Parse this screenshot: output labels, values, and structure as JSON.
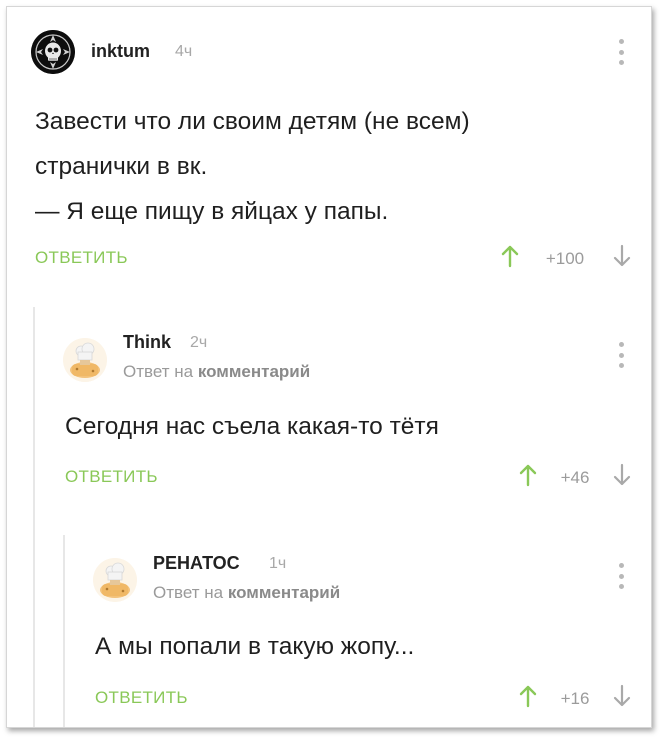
{
  "accent_color": "#8ac858",
  "comments": [
    {
      "author": "inktum",
      "time": "4ч",
      "avatar_icon": "skull-emblem",
      "reply_prefix": "",
      "reply_link": "",
      "lines": [
        "Завести что ли своим детям (не всем)",
        "странички в вк.",
        "— Я еще пищу в яйцах у папы."
      ],
      "reply_label": "ОТВЕТИТЬ",
      "score": "+100"
    },
    {
      "author": "Think",
      "time": "2ч",
      "avatar_icon": "cook-avatar",
      "reply_prefix": "Ответ на ",
      "reply_link": "комментарий",
      "lines": [
        "Сегодня нас съела какая-то тётя"
      ],
      "reply_label": "ОТВЕТИТЬ",
      "score": "+46"
    },
    {
      "author": "РЕНАТОС",
      "time": "1ч",
      "avatar_icon": "cook-avatar",
      "reply_prefix": "Ответ на ",
      "reply_link": "комментарий",
      "lines": [
        "А мы попали в такую жопу..."
      ],
      "reply_label": "ОТВЕТИТЬ",
      "score": "+16"
    }
  ]
}
